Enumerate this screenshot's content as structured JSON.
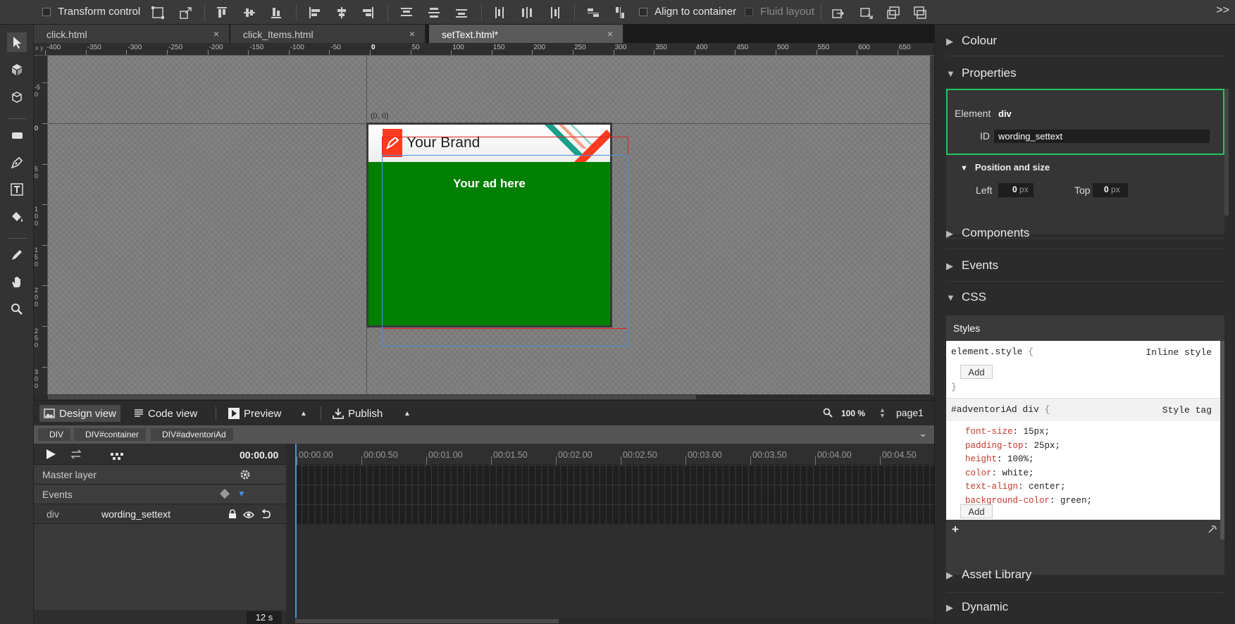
{
  "toolbar": {
    "transform_control": "Transform control",
    "align_to_container": "Align to container",
    "fluid_layout": "Fluid layout",
    "overflow": ">>"
  },
  "tabs": [
    {
      "label": "click.html",
      "close": "×"
    },
    {
      "label": "click_Items.html",
      "close": "×"
    },
    {
      "label": "setText.html*",
      "close": "×"
    }
  ],
  "ruler": {
    "h_ticks": [
      "-400",
      "-350",
      "-300",
      "-250",
      "-200",
      "-150",
      "-100",
      "-50",
      "0",
      "50",
      "100",
      "150",
      "200",
      "250",
      "300",
      "350",
      "400",
      "450",
      "500",
      "550",
      "600",
      "650"
    ],
    "corner": "x y",
    "v_ticks": [
      "-50",
      "0",
      "50",
      "100",
      "150",
      "200",
      "250",
      "300"
    ]
  },
  "stage": {
    "origin_label": "(0, 0)",
    "brand": "Your Brand",
    "ad_text": "Your ad here",
    "ad_bg": "#008000",
    "accent": "#ff3b1f"
  },
  "viewbar": {
    "design_view": "Design view",
    "code_view": "Code view",
    "preview": "Preview",
    "publish": "Publish",
    "zoom": "100 %",
    "page": "page1"
  },
  "breadcrumb": [
    "DIV",
    "DIV#container",
    "DIV#adventoriAd"
  ],
  "timeline": {
    "time": "00:00.00",
    "master_layer": "Master layer",
    "events": "Events",
    "element_type": "div",
    "element_id": "wording_settext",
    "duration": "12 s",
    "marks": [
      "00:00.00",
      "00:00.50",
      "00:01.00",
      "00:01.50",
      "00:02.00",
      "00:02.50",
      "00:03.00",
      "00:03.50",
      "00:04.00",
      "00:04.50"
    ]
  },
  "panel": {
    "colour": "Colour",
    "properties": "Properties",
    "element_label": "Element",
    "element_value": "div",
    "id_label": "ID",
    "id_value": "wording_settext",
    "pos_size": "Position and size",
    "left_label": "Left",
    "left_value": "0",
    "top_label": "Top",
    "top_value": "0",
    "unit": "px",
    "components": "Components",
    "events": "Events",
    "css": "CSS",
    "styles": "Styles",
    "element_style": "element.style",
    "inline_style": "Inline style",
    "add": "Add",
    "open_brace": "{",
    "close_brace": "}",
    "rule_selector": "#adventoriAd div",
    "style_tag": "Style tag",
    "css_rules": [
      {
        "prop": "font-size",
        "val": "15px;"
      },
      {
        "prop": "padding-top",
        "val": "25px;"
      },
      {
        "prop": "height",
        "val": "100%;"
      },
      {
        "prop": "color",
        "val": "white;"
      },
      {
        "prop": "text-align",
        "val": "center;"
      },
      {
        "prop": "background-color",
        "val": "green;"
      }
    ],
    "plus": "+",
    "asset_library": "Asset Library",
    "dynamic": "Dynamic"
  }
}
